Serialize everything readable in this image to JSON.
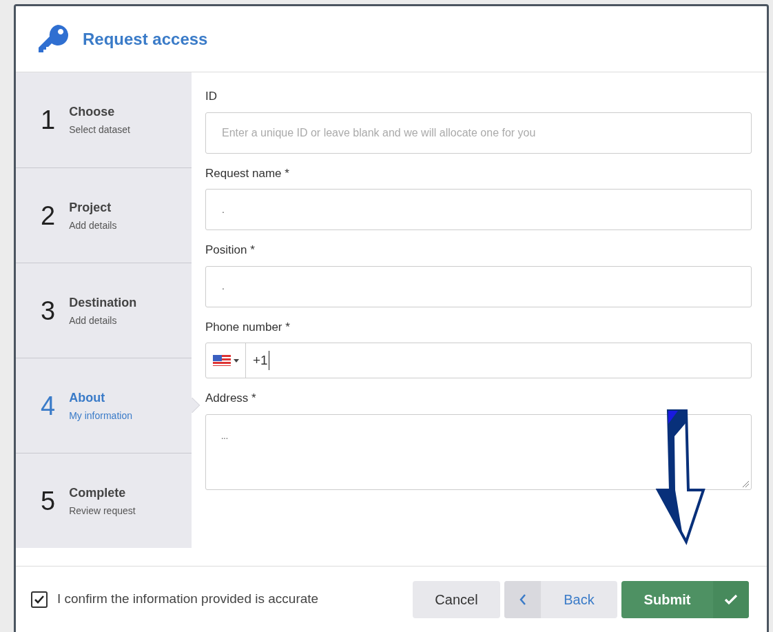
{
  "dialog": {
    "title": "Request access"
  },
  "steps": [
    {
      "number": "1",
      "title": "Choose",
      "subtitle": "Select dataset",
      "selected": false
    },
    {
      "number": "2",
      "title": "Project",
      "subtitle": "Add details",
      "selected": false
    },
    {
      "number": "3",
      "title": "Destination",
      "subtitle": "Add details",
      "selected": false
    },
    {
      "number": "4",
      "title": "About",
      "subtitle": "My information",
      "selected": true
    },
    {
      "number": "5",
      "title": "Complete",
      "subtitle": "Review request",
      "selected": false
    }
  ],
  "fields": [
    {
      "kind": "text",
      "label": "ID",
      "placeholder": "Enter a unique ID or leave blank and we will allocate one for you"
    },
    {
      "kind": "text",
      "label": "Request name *",
      "value": "."
    },
    {
      "kind": "text",
      "label": "Position *",
      "value": "."
    },
    {
      "kind": "phone",
      "label": "Phone number *",
      "value": "+1"
    },
    {
      "kind": "textarea",
      "label": "Address *",
      "value": "..."
    }
  ],
  "confirm": {
    "label": "I confirm the information provided is accurate",
    "checked": true
  },
  "buttons": [
    {
      "kind": "cancel",
      "label": "Cancel"
    },
    {
      "kind": "back",
      "label": "Back"
    },
    {
      "kind": "submit",
      "label": "Submit"
    }
  ]
}
